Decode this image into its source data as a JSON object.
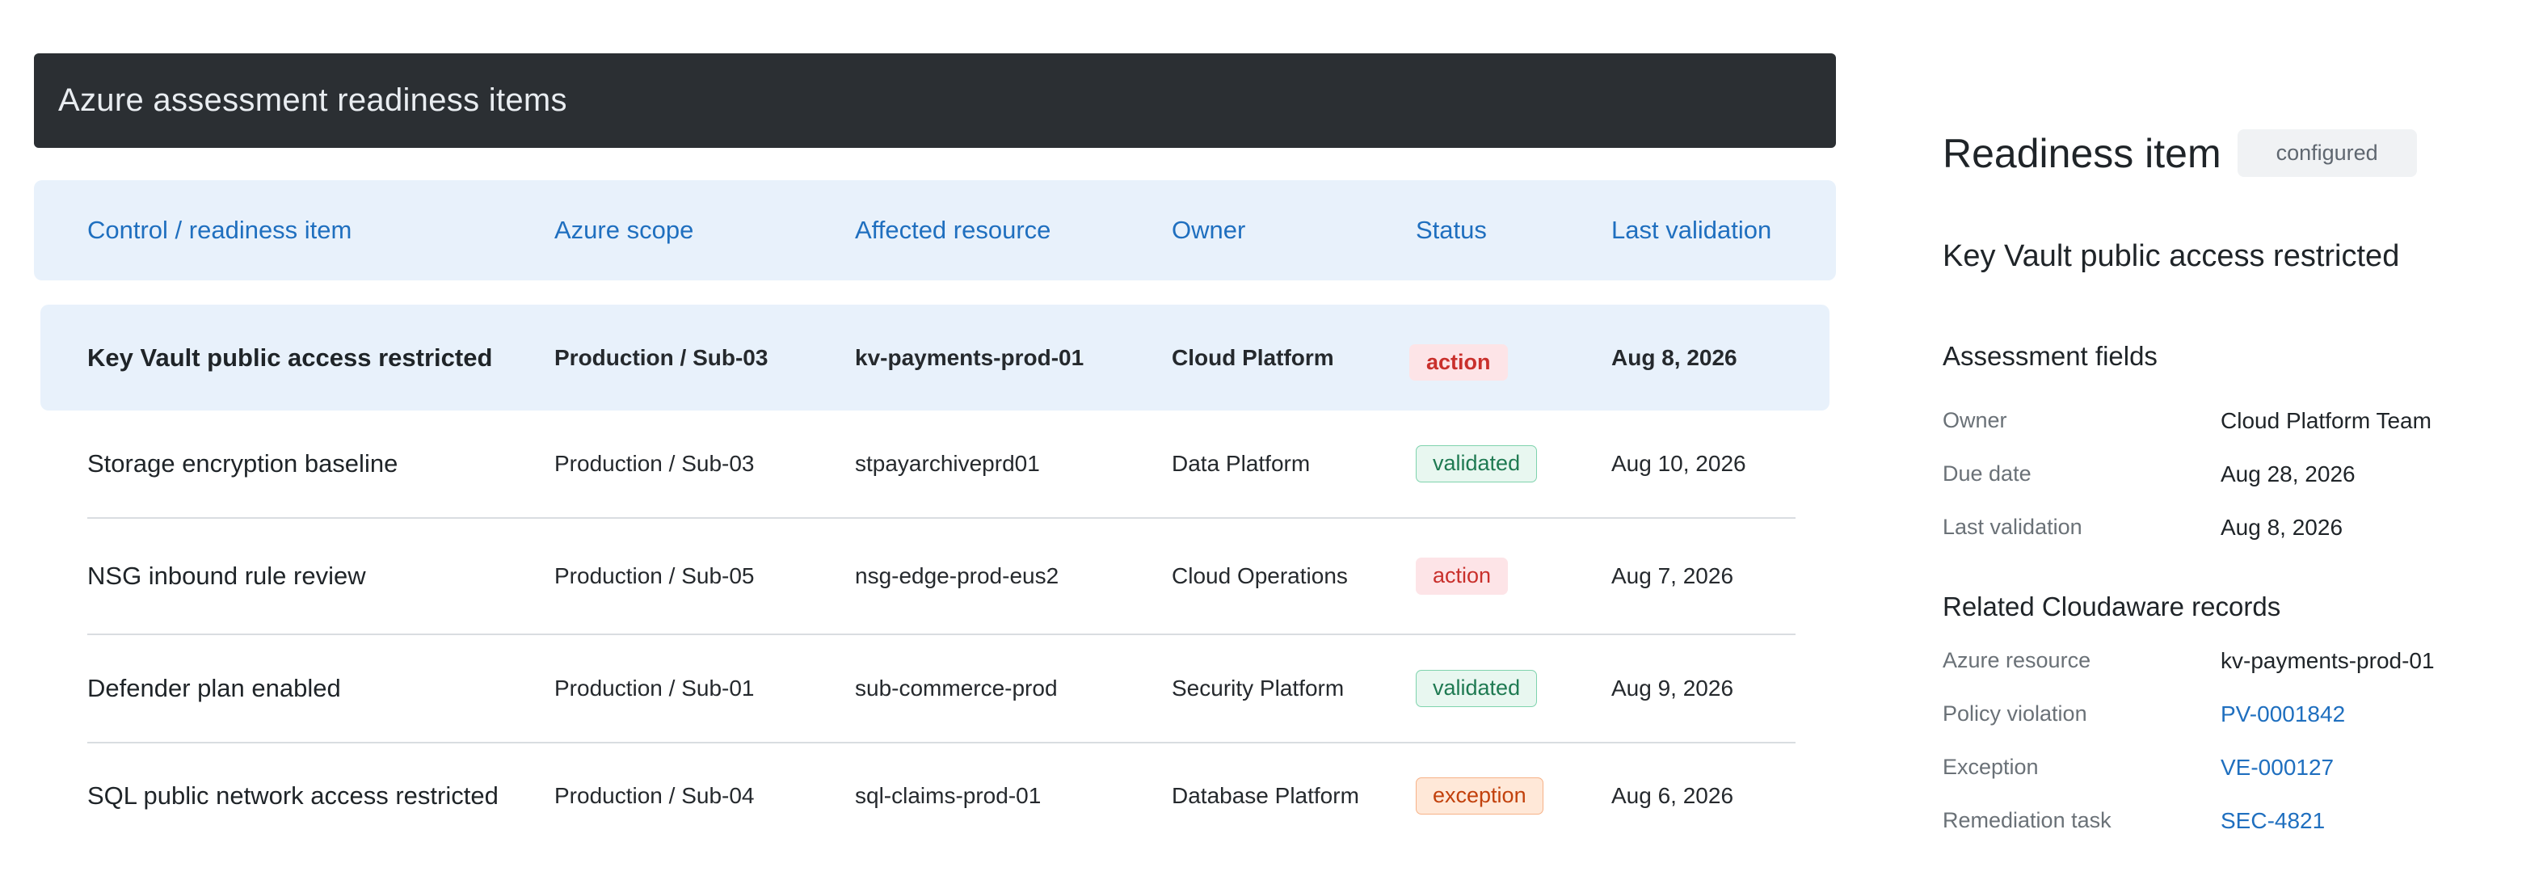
{
  "header": {
    "title": "Azure assessment readiness items"
  },
  "table": {
    "columns": [
      "Control / readiness item",
      "Azure scope",
      "Affected resource",
      "Owner",
      "Status",
      "Last validation"
    ],
    "rows": [
      {
        "item": "Key Vault public access restricted",
        "scope": "Production / Sub-03",
        "resource": "kv-payments-prod-01",
        "owner": "Cloud Platform",
        "status": "action",
        "last_validation": "Aug 8, 2026",
        "selected": true
      },
      {
        "item": "Storage encryption baseline",
        "scope": "Production / Sub-03",
        "resource": "stpayarchiveprd01",
        "owner": "Data Platform",
        "status": "validated",
        "last_validation": "Aug 10, 2026"
      },
      {
        "item": "NSG inbound rule review",
        "scope": "Production / Sub-05",
        "resource": "nsg-edge-prod-eus2",
        "owner": "Cloud Operations",
        "status": "action",
        "last_validation": "Aug 7, 2026"
      },
      {
        "item": "Defender plan enabled",
        "scope": "Production / Sub-01",
        "resource": "sub-commerce-prod",
        "owner": "Security Platform",
        "status": "validated",
        "last_validation": "Aug 9, 2026"
      },
      {
        "item": "SQL public network access restricted",
        "scope": "Production / Sub-04",
        "resource": "sql-claims-prod-01",
        "owner": "Database Platform",
        "status": "exception",
        "last_validation": "Aug 6, 2026"
      }
    ]
  },
  "detail": {
    "heading": "Readiness item",
    "state": "configured",
    "item_title": "Key Vault public access restricted",
    "assessment_heading": "Assessment fields",
    "assessment_fields": [
      {
        "label": "Owner",
        "value": "Cloud Platform Team"
      },
      {
        "label": "Due date",
        "value": "Aug 28, 2026"
      },
      {
        "label": "Last validation",
        "value": "Aug 8, 2026"
      }
    ],
    "related_heading": "Related Cloudaware records",
    "related_fields": [
      {
        "label": "Azure resource",
        "value": "kv-payments-prod-01"
      },
      {
        "label": "Policy violation",
        "value": "PV-0001842"
      },
      {
        "label": "Exception",
        "value": "VE-000127"
      },
      {
        "label": "Remediation task",
        "value": "SEC-4821"
      }
    ]
  },
  "colors": {
    "title_bar": "#2b2f33",
    "header_bg": "#e8f1fb",
    "accent": "#1f6fbf",
    "action": "#c9302c",
    "validated": "#1f7a52",
    "exception": "#c2410c"
  }
}
